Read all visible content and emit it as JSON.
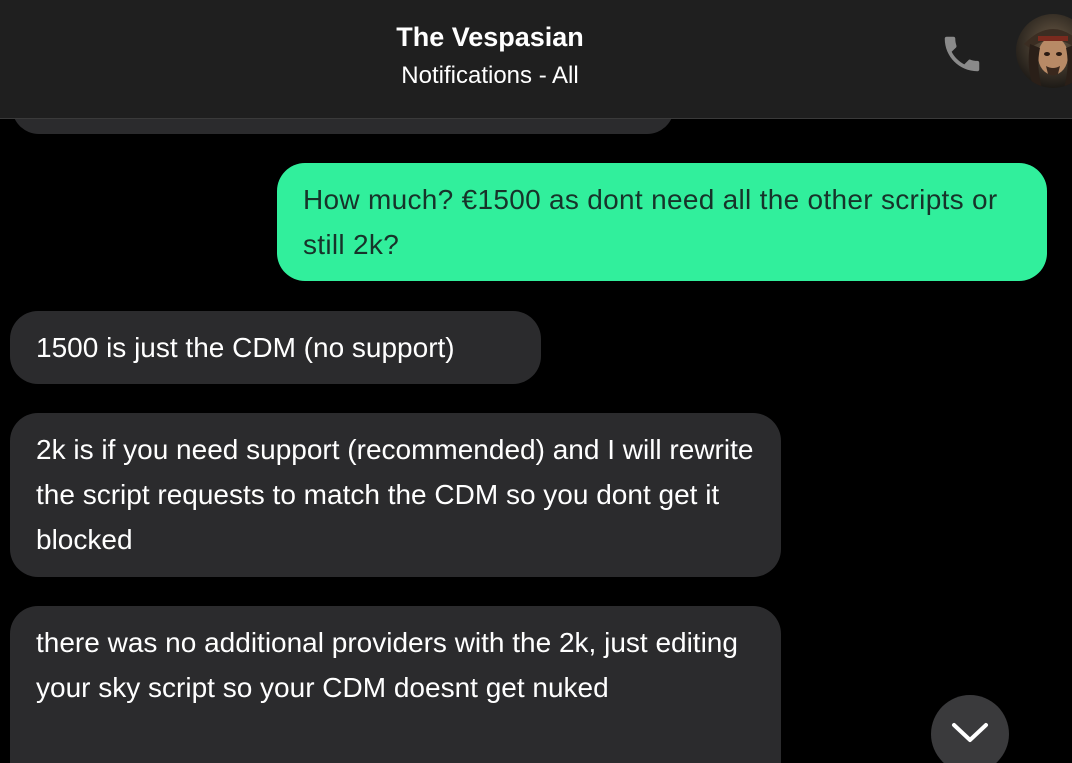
{
  "header": {
    "title": "The Vespasian",
    "subtitle": "Notifications - All",
    "call_icon": "phone-icon",
    "avatar_icon": "contact-avatar"
  },
  "messages": [
    {
      "direction": "incoming",
      "text": ""
    },
    {
      "direction": "outgoing",
      "text": "How much? €1500 as dont need all the other scripts or still 2k?"
    },
    {
      "direction": "incoming",
      "text": "1500 is just the CDM (no support)"
    },
    {
      "direction": "incoming",
      "text": "2k is if you need support (recommended) and I will rewrite the script requests to match the CDM so you dont get it blocked"
    },
    {
      "direction": "incoming",
      "text": "there was no additional providers with the 2k, just editing your sky script so your CDM doesnt get nuked"
    }
  ],
  "scroll_button": {
    "icon": "chevron-down-icon"
  },
  "colors": {
    "header_bg": "#1f1f1f",
    "incoming_bubble": "#2b2b2d",
    "outgoing_bubble": "#31ef9c",
    "background": "#000000"
  }
}
